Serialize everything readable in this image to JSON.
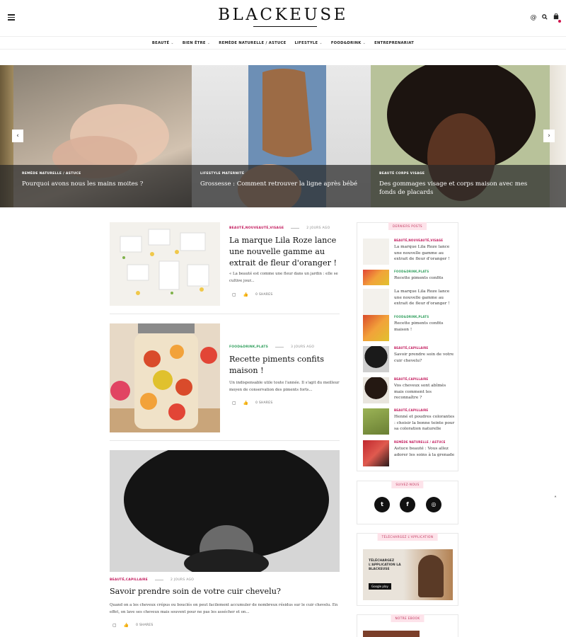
{
  "header": {
    "logo": "BLACKEUSE",
    "icons": [
      "at-icon",
      "search-icon",
      "bag-icon"
    ],
    "icon_glyphs": {
      "at": "@",
      "search": "🔍",
      "bag": "🛍"
    }
  },
  "nav": {
    "items": [
      {
        "label": "BEAUTÉ",
        "has_dropdown": true
      },
      {
        "label": "BIEN ÊTRE",
        "has_dropdown": true
      },
      {
        "label": "REMÈDE NATURELLE / ASTUCE",
        "has_dropdown": false
      },
      {
        "label": "LIFESTYLE",
        "has_dropdown": true
      },
      {
        "label": "FOOD&DRINK",
        "has_dropdown": true
      },
      {
        "label": "ENTREPRENARIAT",
        "has_dropdown": false
      }
    ]
  },
  "slider": {
    "slides": [
      {
        "category": "REMÈDE NATURELLE / ASTUCE",
        "title": "Pourquoi avons nous les mains moites ?"
      },
      {
        "category": "LIFESTYLE MATERNITÉ",
        "title": "Grossesse : Comment retrouver la ligne après bébé"
      },
      {
        "category": "BEAUTÉ CORPS VISAGE",
        "title": "Des gommages visage et corps maison avec mes fonds de placards"
      }
    ],
    "prev_label": "‹",
    "next_label": "›"
  },
  "posts": [
    {
      "category": "BEAUTÉ,NOUVEAUTÉ,VISAGE",
      "category_color": "#c2185b",
      "date": "2 JOURS AGO",
      "title": "La marque Lila Roze lance une nouvelle gamme au extrait de fleur d'oranger !",
      "excerpt": "« La beauté est comme une fleur dans un jardin : elle se cultive jour...",
      "shares": "0 SHARES"
    },
    {
      "category": "FOOD&DRINK,PLATS",
      "category_color": "#2e9e5b",
      "date": "3 JOURS AGO",
      "title": "Recette piments confits maison !",
      "excerpt": "Un indispensable utile toute l'année. Il s'agit du meilleur moyen de conservation des piments forts...",
      "shares": "0 SHARES"
    },
    {
      "category": "BEAUTÉ,CAPILLAIRE",
      "category_color": "#c2185b",
      "date": "2 JOURS AGO",
      "title": "Savoir prendre soin de votre cuir chevelu?",
      "excerpt": "Quand on a les cheveux crépus ou bouclés on peut facilement accumuler de nombreux résidus sur le cuir chevelu. En effet, on lave ses cheveux mais souvent pour ne pas les assécher et on...",
      "shares": "0 SHARES"
    }
  ],
  "sidebar": {
    "recent_title": "DERNIERS POSTS",
    "recent": [
      {
        "category": "BEAUTÉ,NOUVEAUTÉ,VISAGE",
        "color": "#c2185b",
        "title": "La marque Lila Roze lance une nouvelle gamme au extrait de fleur d'oranger !"
      },
      {
        "category": "FOOD&DRINK,PLATS",
        "color": "#2e9e5b",
        "title": "Recette piments confits"
      },
      {
        "category": "",
        "color": "#c2185b",
        "title": "La marque Lila Roze lance une nouvelle gamme au extrait de fleur d'oranger !"
      },
      {
        "category": "FOOD&DRINK,PLATS",
        "color": "#2e9e5b",
        "title": "Recette piments confits maison !"
      },
      {
        "category": "BEAUTÉ,CAPILLAIRE",
        "color": "#c2185b",
        "title": "Savoir prendre soin de votre cuir chevelu?"
      },
      {
        "category": "BEAUTÉ,CAPILLAIRE",
        "color": "#c2185b",
        "title": "Vos cheveux sont abîmés mais comment les reconnaître ?"
      },
      {
        "category": "BEAUTÉ,CAPILLAIRE",
        "color": "#c2185b",
        "title": "Henné et poudres colorantes : choisir la bonne teinte pour sa coloration naturelle"
      },
      {
        "category": "REMÈDE NATURELLE / ASTUCE",
        "color": "#c2185b",
        "title": "Astuce beauté : Vous allez adorer les soins à la grenade"
      }
    ],
    "follow_title": "SUIVEZ-NOUS",
    "social": [
      {
        "name": "twitter",
        "glyph": "t"
      },
      {
        "name": "facebook",
        "glyph": "f"
      },
      {
        "name": "instagram",
        "glyph": "◎"
      }
    ],
    "app_title": "TÉLÉCHARGEZ L'APPLICATION",
    "app_text": "TÉLÉCHARGEZ L'APPLICATION LA BLACKEUSE",
    "app_store": "Google play",
    "shop_title": "NOTRE EBOOK"
  },
  "accent": "#c2185b"
}
